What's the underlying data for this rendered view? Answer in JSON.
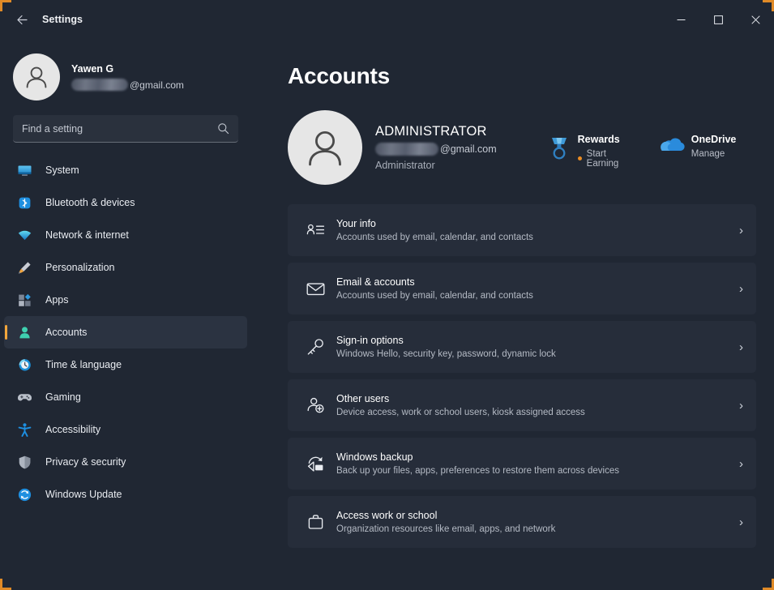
{
  "window": {
    "title": "Settings",
    "back_icon": "back-arrow-icon",
    "minimize_label": "─",
    "maximize_label": "□",
    "close_label": "✕",
    "accent_color": "#e08a27"
  },
  "sidebar": {
    "profile": {
      "name": "Yawen G",
      "email_domain": "@gmail.com",
      "email_redacted": true
    },
    "search": {
      "placeholder": "Find a setting",
      "icon": "search-icon"
    },
    "items": [
      {
        "label": "System",
        "icon": "monitor-icon",
        "active": false
      },
      {
        "label": "Bluetooth & devices",
        "icon": "bluetooth-icon",
        "active": false
      },
      {
        "label": "Network & internet",
        "icon": "wifi-icon",
        "active": false
      },
      {
        "label": "Personalization",
        "icon": "paintbrush-icon",
        "active": false
      },
      {
        "label": "Apps",
        "icon": "apps-grid-icon",
        "active": false
      },
      {
        "label": "Accounts",
        "icon": "person-icon",
        "active": true
      },
      {
        "label": "Time & language",
        "icon": "clock-icon",
        "active": false
      },
      {
        "label": "Gaming",
        "icon": "gamepad-icon",
        "active": false
      },
      {
        "label": "Accessibility",
        "icon": "accessibility-icon",
        "active": false
      },
      {
        "label": "Privacy & security",
        "icon": "shield-icon",
        "active": false
      },
      {
        "label": "Windows Update",
        "icon": "update-icon",
        "active": false
      }
    ],
    "active_indicator_color": "#f2a63b"
  },
  "main": {
    "page_title": "Accounts",
    "account": {
      "name": "ADMINISTRATOR",
      "email_domain": "@gmail.com",
      "email_redacted": true,
      "role": "Administrator",
      "avatar_icon": "person-avatar-icon"
    },
    "services": [
      {
        "title": "Rewards",
        "subtitle": "Start Earning",
        "icon": "rewards-medal-icon",
        "has_status_dot": true,
        "dot_color": "#eb8c22"
      },
      {
        "title": "OneDrive",
        "subtitle": "Manage",
        "icon": "onedrive-cloud-icon",
        "has_status_dot": false
      }
    ],
    "cards": [
      {
        "title": "Your info",
        "subtitle": "Accounts used by email, calendar, and contacts",
        "icon": "your-info-icon",
        "chevron": "›"
      },
      {
        "title": "Email & accounts",
        "subtitle": "Accounts used by email, calendar, and contacts",
        "icon": "envelope-icon",
        "chevron": "›"
      },
      {
        "title": "Sign-in options",
        "subtitle": "Windows Hello, security key, password, dynamic lock",
        "icon": "key-icon",
        "chevron": "›"
      },
      {
        "title": "Other users",
        "subtitle": "Device access, work or school users, kiosk assigned access",
        "icon": "add-user-icon",
        "chevron": "›"
      },
      {
        "title": "Windows backup",
        "subtitle": "Back up your files, apps, preferences to restore them across devices",
        "icon": "backup-sync-icon",
        "chevron": "›"
      },
      {
        "title": "Access work or school",
        "subtitle": "Organization resources like email, apps, and network",
        "icon": "briefcase-icon",
        "chevron": "›"
      }
    ]
  }
}
